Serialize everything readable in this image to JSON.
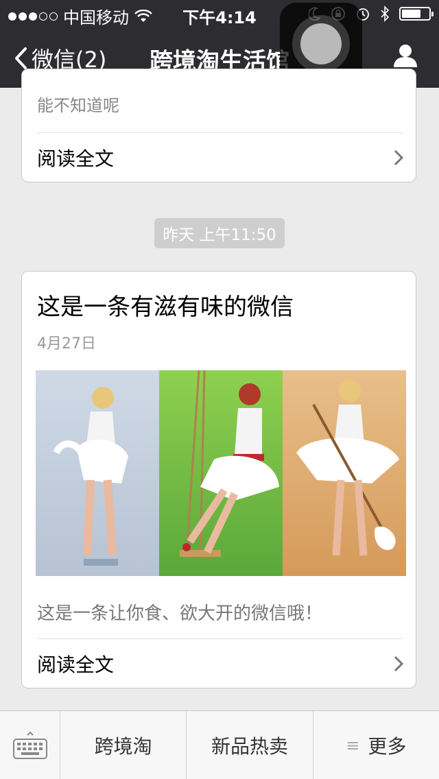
{
  "status_bar": {
    "carrier": "中国移动",
    "time": "下午4:14",
    "icons": [
      "signal-dots-icon",
      "wifi-icon",
      "moon-icon",
      "orientation-lock-icon",
      "alarm-icon",
      "bluetooth-icon",
      "battery-icon"
    ],
    "battery_level": 0.64
  },
  "nav": {
    "back_label": "微信(2)",
    "title": "跨境淘生活馆",
    "profile_icon": "person-icon"
  },
  "messages": [
    {
      "excerpt": "能不知道呢",
      "read_more": "阅读全文"
    },
    {
      "timestamp": "昨天 上午11:50",
      "title": "这是一条有滋有味的微信",
      "date": "4月27日",
      "description": "这是一条让你食、欲大开的微信哦！",
      "read_more": "阅读全文"
    }
  ],
  "bottom_menu": {
    "keyboard_icon": "keyboard-icon",
    "items": [
      "跨境淘",
      "新品热卖",
      "更多"
    ],
    "more_icon": "menu-lines-icon"
  },
  "colors": {
    "nav_bg": "#2d2d31",
    "page_bg": "#ebebeb",
    "timestamp_bg": "#cecece"
  }
}
